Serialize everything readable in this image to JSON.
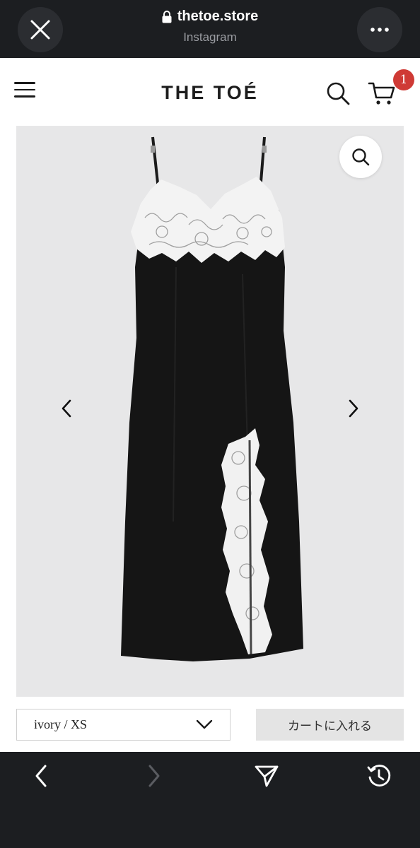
{
  "browser": {
    "domain": "thetoe.store",
    "source_app": "Instagram"
  },
  "site": {
    "logo": "THE TOÉ",
    "cart_count": "1"
  },
  "product": {
    "variant_selected": "ivory / XS",
    "add_to_cart_label": "カートに入れる"
  },
  "icons": {
    "close": "close-icon",
    "more": "more-horizontal-icon",
    "lock": "lock-icon",
    "menu": "hamburger-menu-icon",
    "search": "search-icon",
    "cart": "shopping-cart-icon",
    "zoom": "zoom-search-icon",
    "prev": "chevron-left-icon",
    "next": "chevron-right-icon",
    "dropdown": "chevron-down-icon",
    "back": "back-arrow-icon",
    "forward": "forward-arrow-icon",
    "share": "send-share-icon",
    "history": "history-icon"
  },
  "colors": {
    "browser_chrome": "#1c1e21",
    "badge": "#cf3a35",
    "gallery_bg": "#e7e7e8",
    "button_bg": "#e4e4e4"
  }
}
